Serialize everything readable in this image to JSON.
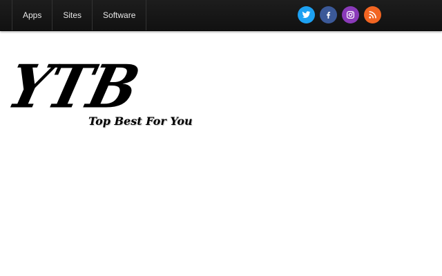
{
  "nav": {
    "items": [
      {
        "label": "Apps"
      },
      {
        "label": "Sites"
      },
      {
        "label": "Software"
      }
    ]
  },
  "social": {
    "icons": [
      {
        "name": "twitter-icon",
        "color": "#1da1f2"
      },
      {
        "name": "facebook-icon",
        "color": "#3b5998"
      },
      {
        "name": "instagram-icon",
        "color": "#8a3ab9"
      },
      {
        "name": "rss-icon",
        "color": "#f26522"
      }
    ]
  },
  "logo": {
    "main": "YTB",
    "tagline": "Top Best For You"
  }
}
